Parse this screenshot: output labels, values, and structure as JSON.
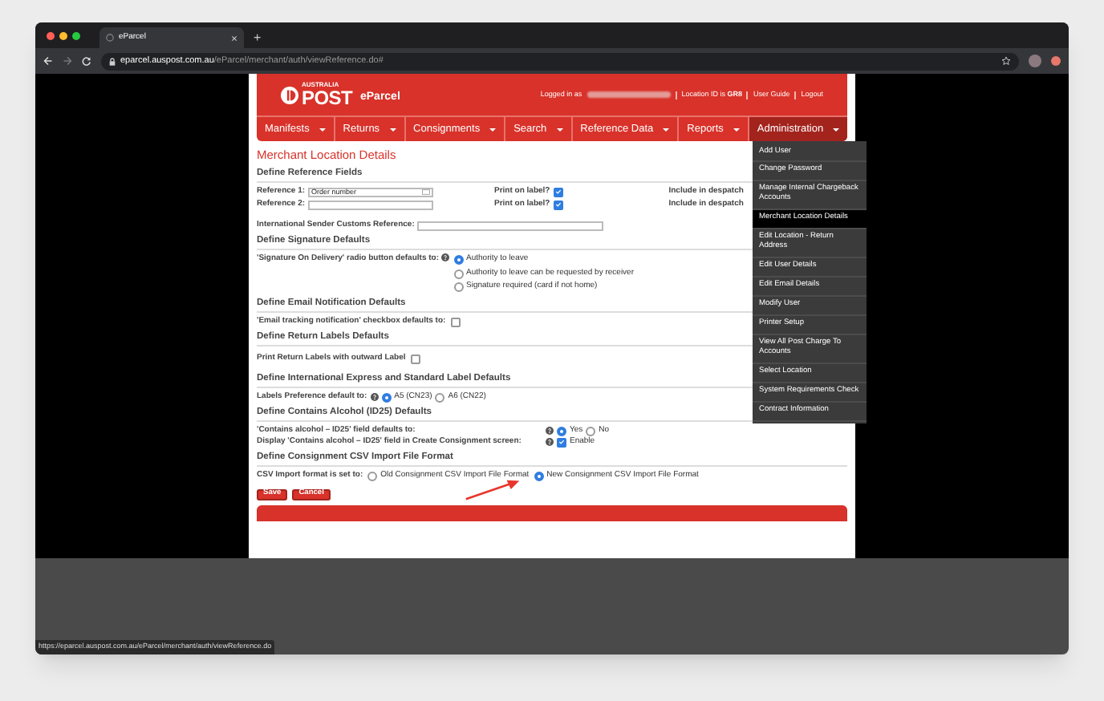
{
  "browser": {
    "tab_title": "eParcel",
    "new_tab": "+",
    "url_host": "eparcel.auspost.com.au",
    "url_path": "/eParcel/merchant/auth/viewReference.do#",
    "status_url": "https://eparcel.auspost.com.au/eParcel/merchant/auth/viewReference.do"
  },
  "header": {
    "logo_small": "AUSTRALIA",
    "logo_word": "POST",
    "product": "eParcel",
    "logged_in_label": "Logged in as",
    "location": "Location ID is **GR8**",
    "links": [
      "User Guide",
      "Logout"
    ]
  },
  "nav": [
    {
      "label": "Manifests",
      "selected": false
    },
    {
      "label": "Returns",
      "selected": false
    },
    {
      "label": "Consignments",
      "selected": false
    },
    {
      "label": "Search",
      "selected": false
    },
    {
      "label": "Reference Data",
      "selected": false
    },
    {
      "label": "Reports",
      "selected": false
    },
    {
      "label": "Administration",
      "selected": true
    }
  ],
  "admin_menu": [
    {
      "label": "Add User",
      "selected": false
    },
    {
      "label": "Change Password",
      "selected": false
    },
    {
      "label": "Manage Internal Chargeback Accounts",
      "selected": false
    },
    {
      "label": "Merchant Location Details",
      "selected": true
    },
    {
      "label": "Edit Location - Return Address",
      "selected": false
    },
    {
      "label": "Edit User Details",
      "selected": false
    },
    {
      "label": "Edit Email Details",
      "selected": false
    },
    {
      "label": "Modify User",
      "selected": false
    },
    {
      "label": "Printer Setup",
      "selected": false
    },
    {
      "label": "View All Post Charge To Accounts",
      "selected": false
    },
    {
      "label": "Select Location",
      "selected": false
    },
    {
      "label": "System Requirements Check",
      "selected": false
    },
    {
      "label": "Contract Information",
      "selected": false
    }
  ],
  "page_title": "Merchant Location Details",
  "reference_fields": {
    "heading": "Define Reference Fields",
    "rows": [
      {
        "label": "Reference 1:",
        "value": "Order number",
        "print_label": "Print on label?",
        "print_checked": true,
        "despatch_label": "Include in despatch"
      },
      {
        "label": "Reference 2:",
        "print_label": "Print on label?",
        "print_checked": true,
        "despatch_label": "Include in despatch"
      }
    ]
  },
  "customs": {
    "label": "International Sender Customs Reference:"
  },
  "signature": {
    "heading": "Define Signature Defaults",
    "label": "'Signature On Delivery' radio button defaults to:",
    "options": [
      {
        "label": "Authority to leave",
        "selected": true
      },
      {
        "label": "Authority to leave can be requested by receiver",
        "selected": false
      },
      {
        "label": "Signature required (card if not home)",
        "selected": false
      }
    ]
  },
  "email": {
    "heading": "Define Email Notification Defaults",
    "label": "'Email tracking notification' checkbox defaults to:",
    "checked": false
  },
  "return_labels": {
    "heading": "Define Return Labels Defaults",
    "label": "Print Return Labels with outward Label",
    "checked": false
  },
  "intl_labels": {
    "heading": "Define International Express and Standard Label Defaults",
    "label": "Labels Preference default to:",
    "options": [
      {
        "label": "A5 (CN23)",
        "selected": true
      },
      {
        "label": "A6 (CN22)",
        "selected": false
      }
    ]
  },
  "alcohol": {
    "heading": "Define Contains Alcohol (ID25) Defaults",
    "field_label": "'Contains alcohol – ID25' field defaults to:",
    "options": [
      {
        "label": "Yes",
        "selected": true
      },
      {
        "label": "No",
        "selected": false
      }
    ],
    "display_label": "Display 'Contains alcohol – ID25' field in Create Consignment screen:",
    "enable_label": "Enable",
    "enable_checked": true
  },
  "csv": {
    "heading": "Define Consignment CSV Import File Format",
    "label": "CSV Import format is set to:",
    "options": [
      {
        "label": "Old Consignment CSV Import File Format",
        "selected": false
      },
      {
        "label": "New Consignment CSV Import File Format",
        "selected": true
      }
    ]
  },
  "buttons": [
    "Save",
    "Cancel"
  ]
}
